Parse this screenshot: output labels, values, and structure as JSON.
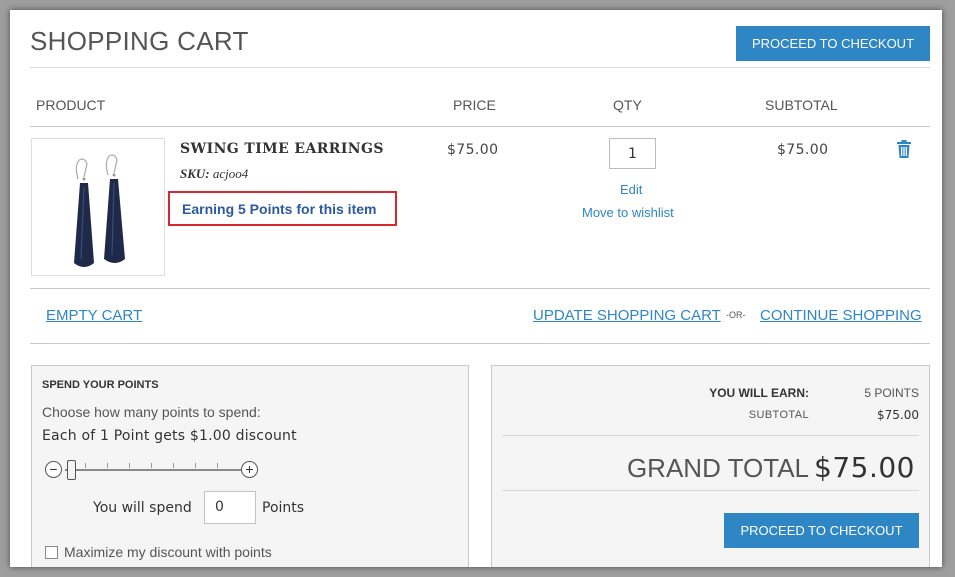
{
  "header": {
    "title": "SHOPPING CART",
    "checkout_label": "PROCEED TO CHECKOUT"
  },
  "columns": {
    "product": "PRODUCT",
    "price": "PRICE",
    "qty": "QTY",
    "subtotal": "SUBTOTAL"
  },
  "item": {
    "name": "SWING TIME EARRINGS",
    "sku_label": "SKU:",
    "sku_value": "acjoo4",
    "earning": "Earning 5 Points for this item",
    "price": "$75.00",
    "qty": "1",
    "edit": "Edit",
    "wishlist": "Move to wishlist",
    "subtotal": "$75.00",
    "earring_color": "#1f2a4a",
    "trash_icon": "trash-icon"
  },
  "actions": {
    "empty": "EMPTY CART",
    "update": "UPDATE SHOPPING CART",
    "or": "-OR-",
    "continue": "CONTINUE SHOPPING"
  },
  "points": {
    "title": "SPEND YOUR POINTS",
    "question": "Choose how many points to spend:",
    "rate": "Each of 1 Point gets $1.00 discount",
    "minus": "−",
    "plus": "+",
    "slider_level": 0,
    "spend_prefix": "You will spend",
    "spend_value": "0",
    "spend_suffix": "Points",
    "maximize": "Maximize my discount with points"
  },
  "totals": {
    "earn_label": "YOU WILL EARN:",
    "earn_value": "5 POINTS",
    "subtotal_label": "SUBTOTAL",
    "subtotal_value": "$75.00",
    "grand_label": "GRAND TOTAL",
    "grand_value": "$75.00",
    "checkout_label": "PROCEED TO CHECKOUT"
  },
  "colors": {
    "accent": "#2f86c5",
    "highlight_border": "#d8272d",
    "earning_text": "#2a5aa0"
  }
}
